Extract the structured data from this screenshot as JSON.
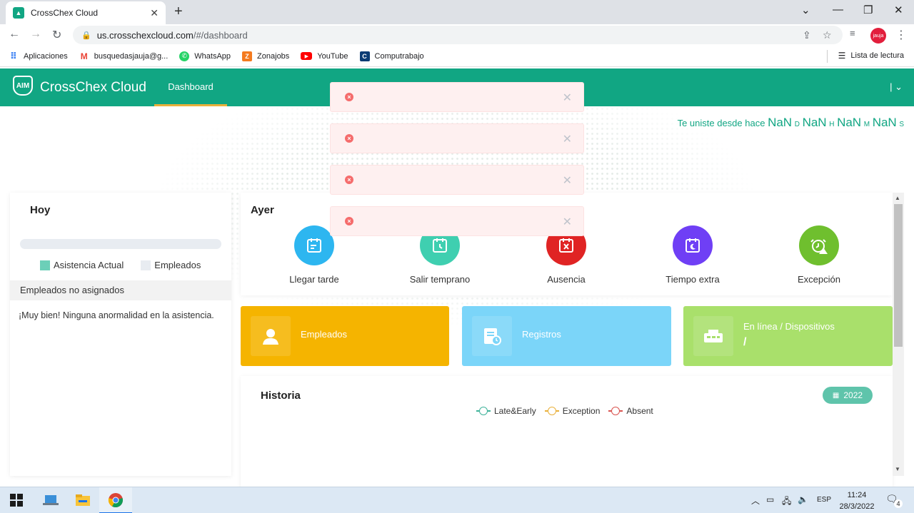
{
  "browser": {
    "tab_title": "CrossChex Cloud",
    "url_host": "us.crosschexcloud.com",
    "url_path": "/#/dashboard",
    "bookmarks": [
      {
        "label": "Aplicaciones",
        "icon": "apps-grid-icon",
        "color": "#4285f4"
      },
      {
        "label": "busquedasjauja@g...",
        "icon": "gmail-icon",
        "color": "#ea4335"
      },
      {
        "label": "WhatsApp",
        "icon": "whatsapp-icon",
        "color": "#25d366"
      },
      {
        "label": "Zonajobs",
        "icon": "zonajobs-icon",
        "color": "#f47b20"
      },
      {
        "label": "YouTube",
        "icon": "youtube-icon",
        "color": "#ff0000"
      },
      {
        "label": "Computrabajo",
        "icon": "computrabajo-icon",
        "color": "#0b3c74"
      }
    ],
    "reading_list": "Lista de lectura",
    "profile_label": "jauja"
  },
  "app": {
    "brand": "CrossChex Cloud",
    "logo_text": "AIM",
    "nav_dashboard": "Dashboard",
    "header_right": "| ⌄",
    "accent": "#11a683"
  },
  "since": {
    "prefix": "Te uniste desde hace",
    "d_value": "NaN",
    "d_unit": "D",
    "h_value": "NaN",
    "h_unit": "H",
    "m_value": "NaN",
    "m_unit": "M",
    "s_value": "NaN",
    "s_unit": "S"
  },
  "hoy": {
    "title": "Hoy",
    "legend_actual": "Asistencia Actual",
    "legend_employees": "Empleados",
    "unassigned_header": "Empleados no asignados",
    "ok_message": "¡Muy bien! Ninguna anormalidad en la asistencia."
  },
  "ayer": {
    "title": "Ayer",
    "stats": [
      {
        "label": "Llegar tarde",
        "color": "#2db6f0",
        "icon": "late-arrival-icon"
      },
      {
        "label": "Salir temprano",
        "color": "#3fcfb0",
        "icon": "early-leave-icon"
      },
      {
        "label": "Ausencia",
        "color": "#e02424",
        "icon": "absence-icon"
      },
      {
        "label": "Tiempo extra",
        "color": "#6f3ff5",
        "icon": "overtime-icon"
      },
      {
        "label": "Excepción",
        "color": "#6fbf2e",
        "icon": "exception-icon"
      }
    ]
  },
  "tiles": {
    "employees": {
      "label": "Empleados",
      "color": "#f5b400",
      "icon": "person-icon"
    },
    "records": {
      "label": "Registros",
      "color": "#7bd5f9",
      "icon": "records-icon"
    },
    "devices": {
      "label": "En línea / Dispositivos",
      "value": "/",
      "color": "#a9e06b",
      "icon": "device-icon"
    }
  },
  "historia": {
    "title": "Historia",
    "year": "2022",
    "legend": [
      {
        "label": "Late&Early",
        "color": "#3fb39a"
      },
      {
        "label": "Exception",
        "color": "#e9b03b"
      },
      {
        "label": "Absent",
        "color": "#d9534f"
      }
    ]
  },
  "toasts": [
    {
      "message": ""
    },
    {
      "message": ""
    },
    {
      "message": ""
    },
    {
      "message": ""
    }
  ],
  "taskbar": {
    "language": "ESP",
    "time": "11:24",
    "date": "28/3/2022",
    "notifications": "4"
  }
}
